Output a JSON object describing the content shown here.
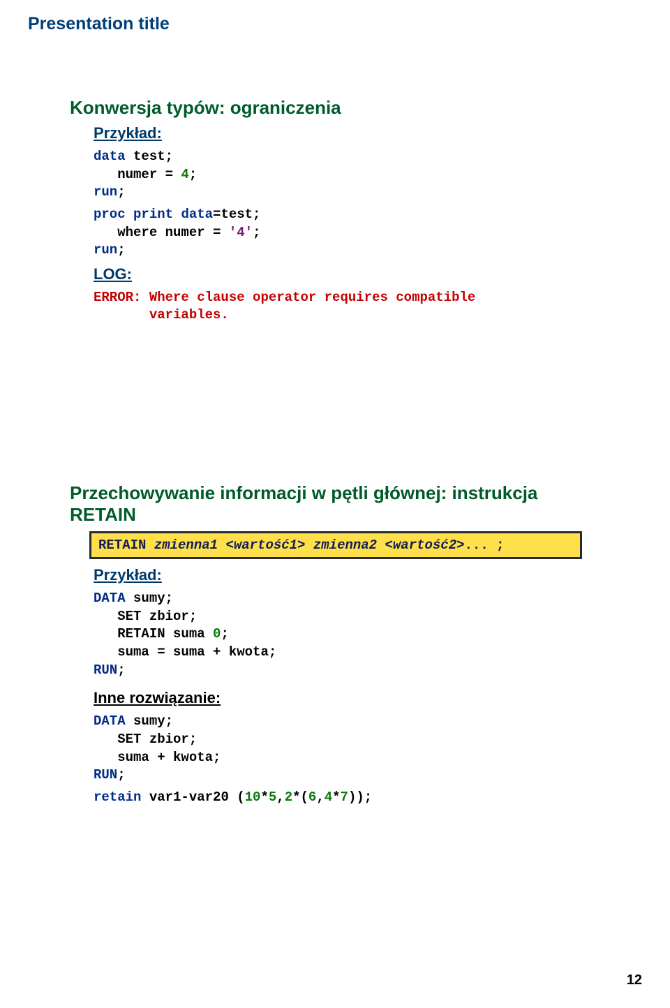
{
  "header": {
    "title": "Presentation title"
  },
  "slide1": {
    "title": "Konwersja typów: ograniczenia",
    "example_label": "Przykład:",
    "code1": {
      "l1a": "data",
      "l1b": " test;",
      "l2a": "   numer = ",
      "l2b": "4",
      "l2c": ";",
      "l3": "run",
      "l4a": "proc",
      "l4b": " ",
      "l4c": "print",
      "l4d": " ",
      "l4e": "data",
      "l4f": "=test;",
      "l5a": "   where numer = ",
      "l5b": "'4'",
      "l5c": ";",
      "l6": "run"
    },
    "log_label": "LOG:",
    "error": "ERROR: Where clause operator requires compatible\n       variables."
  },
  "slide2": {
    "title": "Przechowywanie informacji w pętli głównej: instrukcja RETAIN",
    "syntax": "RETAIN zmienna1 <wartość1> zmienna2 <wartość2>... ;",
    "example_label": "Przykład:",
    "code1": {
      "l1a": "DATA",
      "l1b": " sumy;",
      "l2": "   SET zbior;",
      "l3a": "   RETAIN suma ",
      "l3b": "0",
      "l3c": ";",
      "l4": "   suma = suma + kwota;",
      "l5": "RUN"
    },
    "alt_label": "Inne rozwiązanie:",
    "code2": {
      "l1a": "DATA",
      "l1b": " sumy;",
      "l2": "   SET zbior;",
      "l3": "   suma + kwota;",
      "l4": "RUN"
    },
    "retain_ex": {
      "a": "retain",
      "b": " var1-var20 (",
      "c": "10",
      "d": "*",
      "e": "5",
      "f": ",",
      "g": "2",
      "h": "*(",
      "i": "6",
      "j": ",",
      "k": "4",
      "l": "*",
      "m": "7",
      "n": "));"
    }
  },
  "page_number": "12"
}
